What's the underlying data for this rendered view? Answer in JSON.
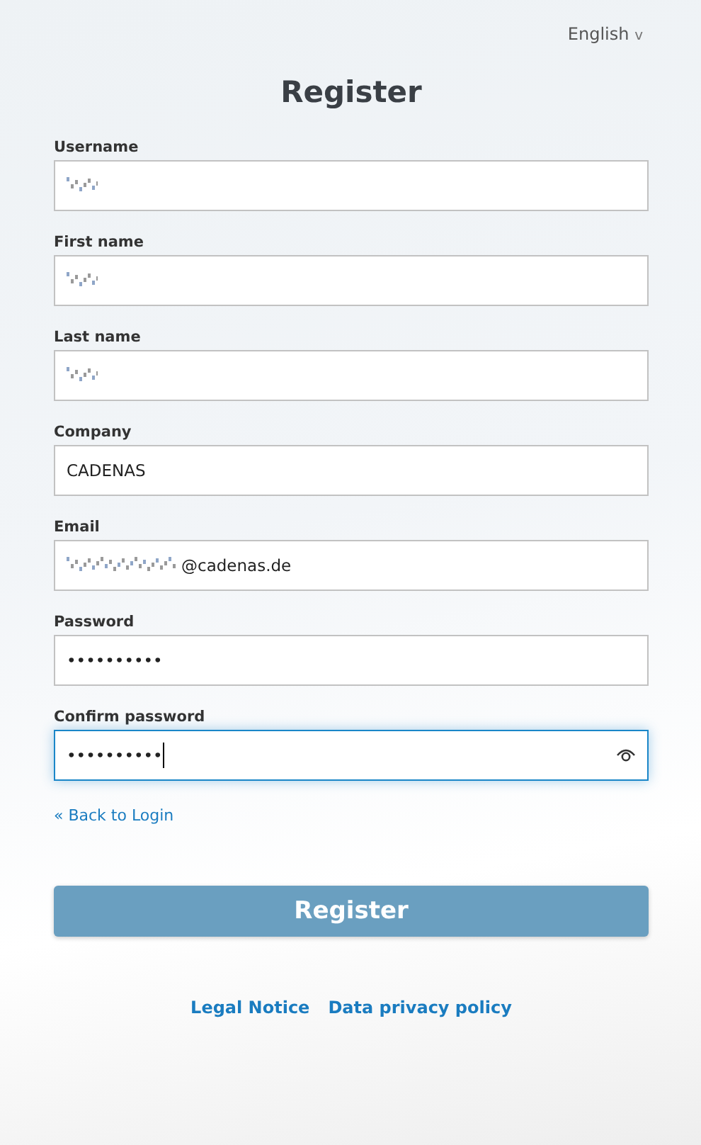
{
  "language": {
    "label": "English",
    "caret": "v"
  },
  "title": "Register",
  "fields": [
    {
      "label": "Username",
      "redacted": true,
      "focused": false,
      "reveal_toggle": false
    },
    {
      "label": "First name",
      "redacted": true,
      "focused": false,
      "reveal_toggle": false
    },
    {
      "label": "Last name",
      "redacted": true,
      "focused": false,
      "reveal_toggle": false
    },
    {
      "label": "Company",
      "value": "CADENAS",
      "redacted": false,
      "focused": false,
      "reveal_toggle": false
    },
    {
      "label": "Email",
      "value": "@cadenas.de",
      "redacted": true,
      "focused": false,
      "reveal_toggle": false
    },
    {
      "label": "Password",
      "value": "••••••••••",
      "redacted": false,
      "focused": false,
      "reveal_toggle": false
    },
    {
      "label": "Confirm password",
      "value": "••••••••••",
      "redacted": false,
      "focused": true,
      "reveal_toggle": true
    }
  ],
  "back_link": "« Back to Login",
  "submit": "Register",
  "footer_links": [
    "Legal Notice",
    "Data privacy policy"
  ]
}
